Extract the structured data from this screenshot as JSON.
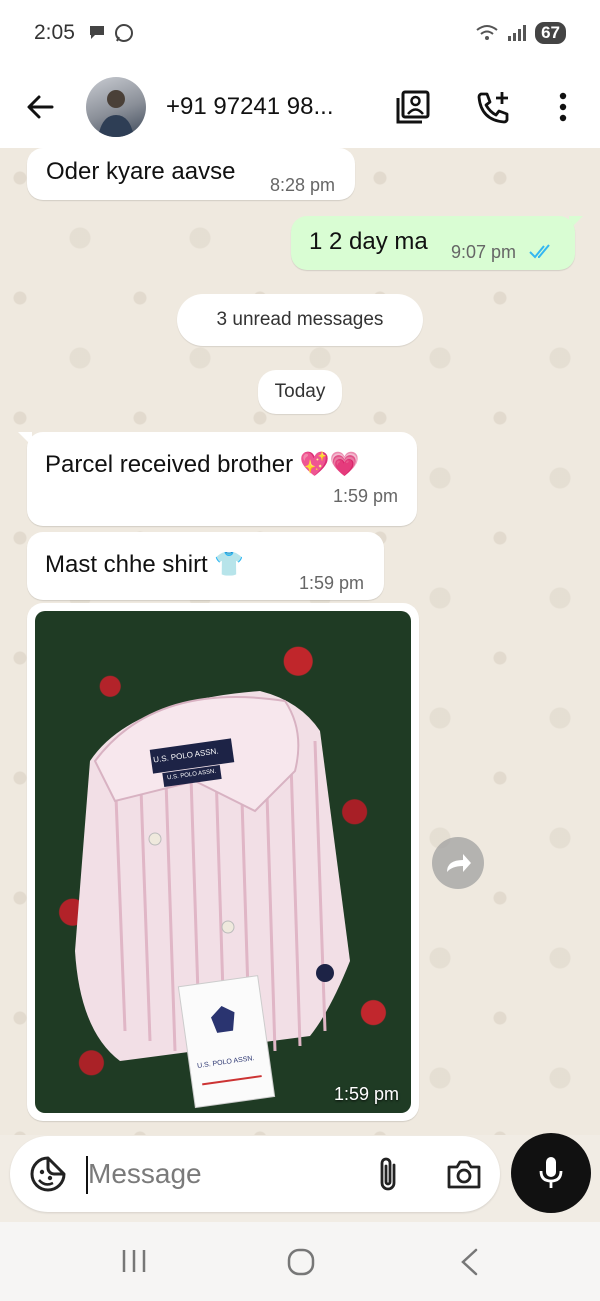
{
  "status_bar": {
    "time": "2:05",
    "battery": "67"
  },
  "header": {
    "contact_name": "+91 97241 98..."
  },
  "messages": [
    {
      "text": "Oder kyare aavse",
      "time": "8:28 pm",
      "direction": "in"
    },
    {
      "text": "1 2 day ma",
      "time": "9:07 pm",
      "direction": "out",
      "read": true
    },
    {
      "text": "Parcel received brother 💖💗",
      "time": "1:59 pm",
      "direction": "in"
    },
    {
      "text": "Mast chhe shirt 👕",
      "time": "1:59 pm",
      "direction": "in"
    },
    {
      "type": "image",
      "time": "1:59 pm",
      "direction": "in"
    }
  ],
  "unread_banner": "3 unread messages",
  "date_chip": "Today",
  "photo": {
    "collar_label_1": "U.S. POLO ASSN.",
    "collar_label_2": "U.S. POLO ASSN.",
    "tag_text": "U.S. POLO ASSN."
  },
  "composer": {
    "placeholder": "Message"
  },
  "colors": {
    "outgoing_bubble": "#d9fdd3",
    "incoming_bubble": "#ffffff",
    "read_ticks": "#34b7f1",
    "mic_button": "#111111"
  },
  "icons": {
    "back": "arrow-left-icon",
    "view_contact": "contact-card-icon",
    "call": "add-call-icon",
    "menu": "more-vert-icon",
    "sticker": "sticker-icon",
    "attach": "paperclip-icon",
    "camera": "camera-icon",
    "mic": "mic-icon",
    "forward": "forward-icon"
  }
}
